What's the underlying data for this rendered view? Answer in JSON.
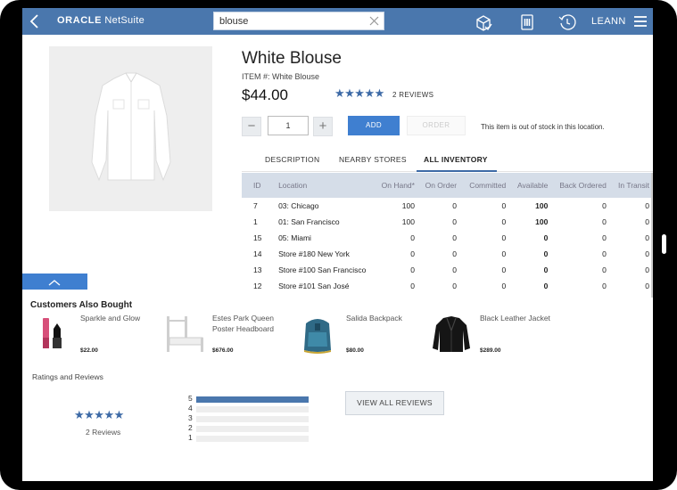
{
  "header": {
    "brand_oracle": "ORACLE",
    "brand_product": "NetSuite",
    "search_value": "blouse",
    "user": "LEANN"
  },
  "product": {
    "title": "White Blouse",
    "item_number": "ITEM #: White Blouse",
    "price": "$44.00",
    "rating": 5,
    "stars": "★★★★★",
    "reviews_label": "2 REVIEWS",
    "quantity": "1",
    "minus_label": "−",
    "plus_label": "+",
    "add_label": "ADD",
    "order_label": "ORDER",
    "stock_note": "This item is out of stock in this location."
  },
  "tabs": [
    {
      "label": "DESCRIPTION",
      "active": false
    },
    {
      "label": "NEARBY STORES",
      "active": false
    },
    {
      "label": "ALL INVENTORY",
      "active": true
    }
  ],
  "inventory": {
    "columns": [
      "ID",
      "Location",
      "On Hand*",
      "On Order",
      "Committed",
      "Available",
      "Back Ordered",
      "In Transit"
    ],
    "rows": [
      [
        "7",
        "03: Chicago",
        "100",
        "0",
        "0",
        "100",
        "0",
        "0"
      ],
      [
        "1",
        "01: San Francisco",
        "100",
        "0",
        "0",
        "100",
        "0",
        "0"
      ],
      [
        "15",
        "05: Miami",
        "0",
        "0",
        "0",
        "0",
        "0",
        "0"
      ],
      [
        "14",
        "Store #180 New York",
        "0",
        "0",
        "0",
        "0",
        "0",
        "0"
      ],
      [
        "13",
        "Store #100 San Francisco",
        "0",
        "0",
        "0",
        "0",
        "0",
        "0"
      ],
      [
        "12",
        "Store #101 San José",
        "0",
        "0",
        "0",
        "0",
        "0",
        "0"
      ]
    ]
  },
  "also_bought": {
    "title": "Customers Also Bought",
    "items": [
      {
        "name": "Sparkle and Glow",
        "price": "$22.00",
        "icon": "lipstick"
      },
      {
        "name": "Estes Park Queen Poster Headboard",
        "price": "$676.00",
        "icon": "bed"
      },
      {
        "name": "Salida Backpack",
        "price": "$80.00",
        "icon": "backpack"
      },
      {
        "name": "Black Leather Jacket",
        "price": "$289.00",
        "icon": "jacket"
      }
    ]
  },
  "ratings": {
    "title": "Ratings and Reviews",
    "stars": "★★★★★",
    "count_label": "2 Reviews",
    "distribution": [
      {
        "star": "5",
        "fraction": 1.0
      },
      {
        "star": "4",
        "fraction": 0.0
      },
      {
        "star": "3",
        "fraction": 0.0
      },
      {
        "star": "2",
        "fraction": 0.0
      },
      {
        "star": "1",
        "fraction": 0.0
      }
    ],
    "view_all_label": "VIEW ALL REVIEWS"
  },
  "colors": {
    "header_bg": "#4a77ad",
    "accent": "#3f7fd0",
    "star": "#3d6aa6"
  }
}
